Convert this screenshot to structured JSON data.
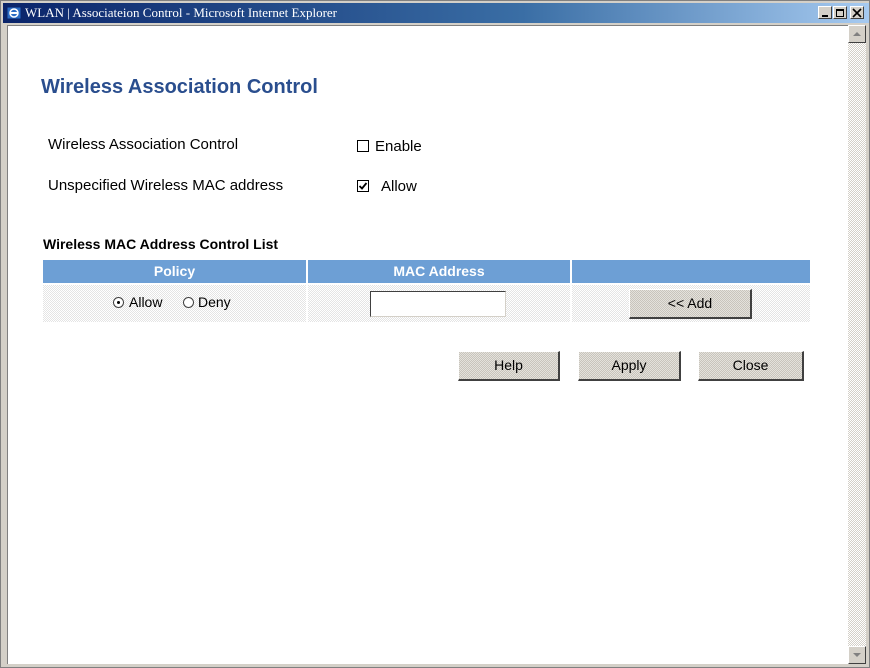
{
  "window": {
    "title": "WLAN | Associateion Control - Microsoft Internet Explorer"
  },
  "page": {
    "title": "Wireless Association Control"
  },
  "settings": {
    "association_control": {
      "label": "Wireless Association Control",
      "checkbox_label": "Enable",
      "checked": false
    },
    "unspecified_mac": {
      "label": "Unspecified Wireless MAC address",
      "checkbox_label": "Allow",
      "checked": true
    }
  },
  "mac_list": {
    "title": "Wireless MAC Address Control List",
    "columns": [
      "Policy",
      "MAC Address",
      ""
    ],
    "policy_options": [
      {
        "label": "Allow",
        "selected": true
      },
      {
        "label": "Deny",
        "selected": false
      }
    ],
    "mac_value": "",
    "add_label": "<< Add"
  },
  "actions": {
    "help_label": "Help",
    "apply_label": "Apply",
    "close_label": "Close"
  },
  "colors": {
    "title_text": "#2a4e8e",
    "table_header": "#6d9fd5"
  }
}
